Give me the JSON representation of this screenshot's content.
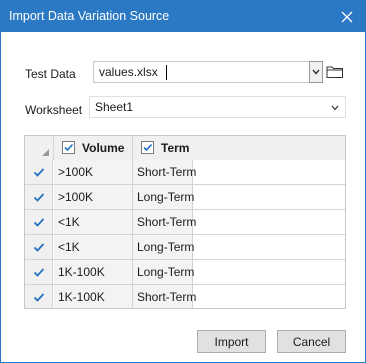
{
  "window": {
    "title": "Import Data Variation Source",
    "accent_color": "#2b78c4"
  },
  "test_data": {
    "label": "Test Data",
    "value": "values.xlsx"
  },
  "worksheet": {
    "label": "Worksheet",
    "value": "Sheet1"
  },
  "grid": {
    "columns": [
      {
        "label": "Volume",
        "checked": true
      },
      {
        "label": "Term",
        "checked": true
      }
    ],
    "rows": [
      {
        "checked": true,
        "volume": ">100K",
        "term": "Short-Term"
      },
      {
        "checked": true,
        "volume": ">100K",
        "term": "Long-Term"
      },
      {
        "checked": true,
        "volume": "<1K",
        "term": "Short-Term"
      },
      {
        "checked": true,
        "volume": "<1K",
        "term": "Long-Term"
      },
      {
        "checked": true,
        "volume": "1K-100K",
        "term": "Long-Term"
      },
      {
        "checked": true,
        "volume": "1K-100K",
        "term": "Short-Term"
      }
    ]
  },
  "buttons": {
    "import": "Import",
    "cancel": "Cancel"
  },
  "icons": {
    "close": "close-icon",
    "dropdown": "chevron-down-icon",
    "folder": "folder-icon",
    "check": "check-icon",
    "sort": "sort-corner-icon"
  }
}
